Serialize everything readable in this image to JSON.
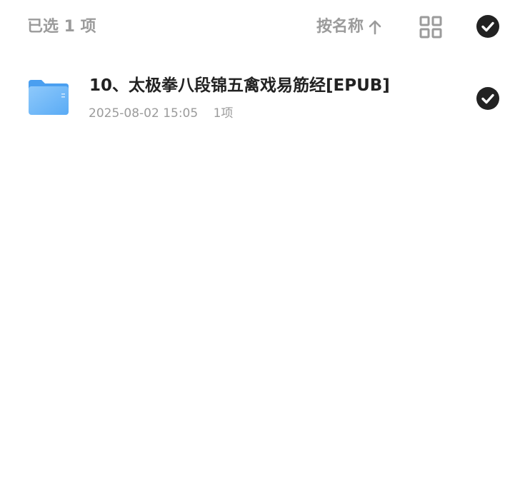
{
  "header": {
    "selected_count_label": "已选 1 项",
    "sort_label": "按名称",
    "sort_icon": "arrow-up-icon",
    "view_toggle_icon": "grid-view-icon",
    "select_all_icon": "check-circle-icon"
  },
  "files": [
    {
      "icon": "folder-icon",
      "name": "10、太极拳八段锦五禽戏易筋经[EPUB]",
      "modified": "2025-08-02 15:05",
      "item_count": "1项",
      "selected": true
    }
  ],
  "colors": {
    "text_primary": "#222222",
    "text_secondary": "#9b9b9b",
    "check_fill": "#222222",
    "folder_blue": "#5aabf5"
  }
}
